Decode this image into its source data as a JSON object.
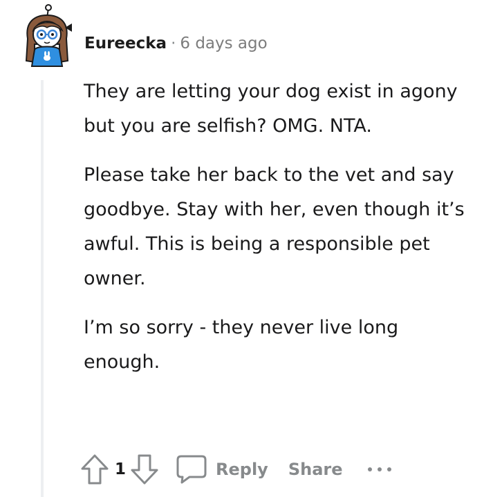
{
  "comment": {
    "author": "Eureecka",
    "separator": "·",
    "timestamp": "6 days ago",
    "paragraphs": [
      "They are letting your dog exist in agony but you are selfish? OMG. NTA.",
      "Please take her back to the vet and say goodbye. Stay with her, even though it’s awful. This is being a responsible pet owner.",
      "I’m so sorry - they never live long enough."
    ]
  },
  "actions": {
    "vote_count": "1",
    "reply_label": "Reply",
    "share_label": "Share"
  },
  "icons": {
    "upvote": "arrow-up-outline",
    "downvote": "arrow-down-outline",
    "reply": "chat-bubble-outline",
    "more": "horizontal-ellipsis"
  },
  "colors": {
    "text": "#1a1a1b",
    "muted": "#878a8c",
    "thread_line": "#edeff1",
    "avatar_shirt": "#2f8fe0",
    "avatar_hair": "#8a5a3c"
  }
}
